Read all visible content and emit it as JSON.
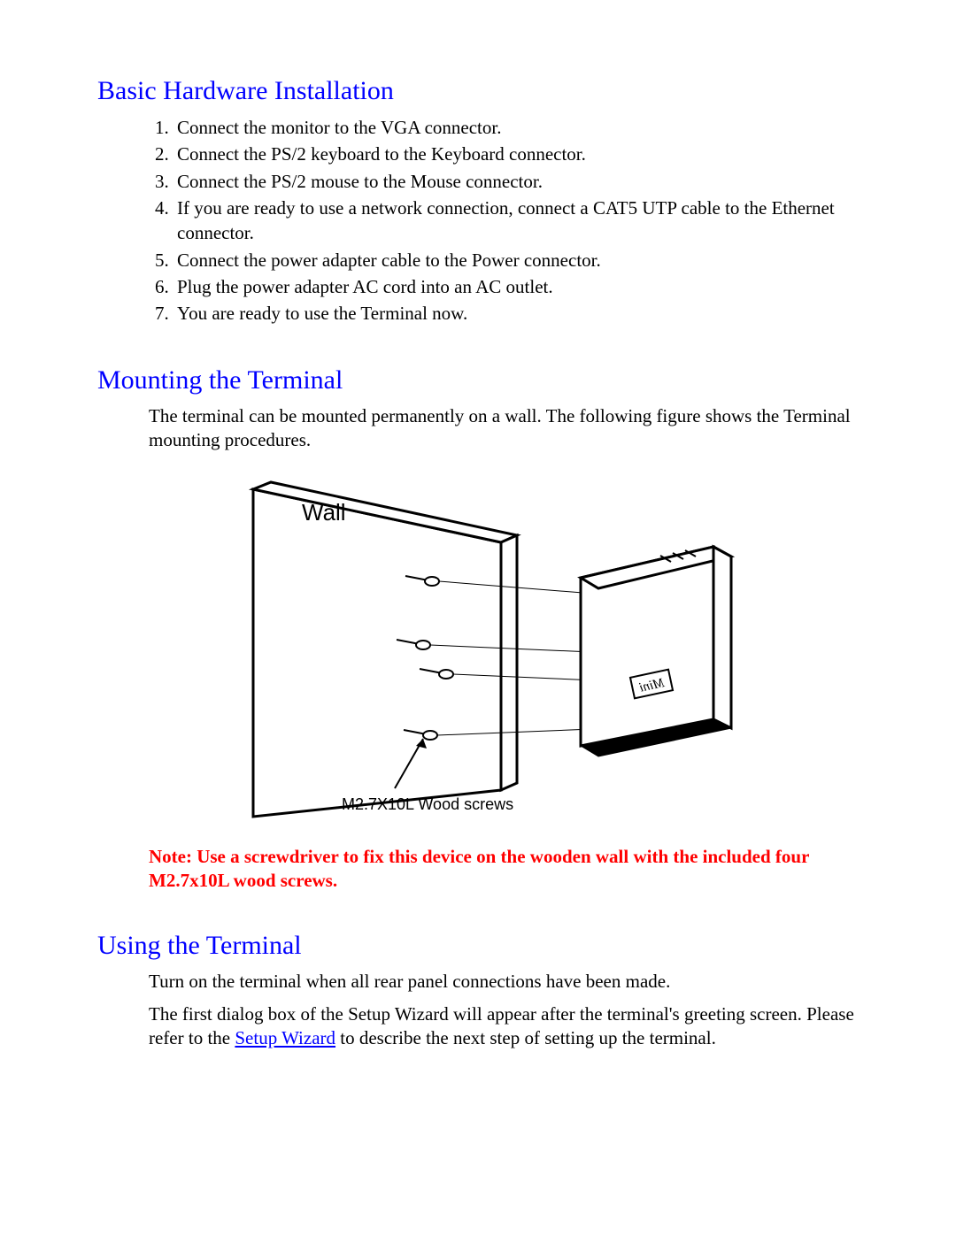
{
  "section1": {
    "heading": "Basic Hardware Installation",
    "steps": [
      "Connect the monitor to the VGA connector.",
      "Connect the PS/2 keyboard to the Keyboard connector.",
      "Connect the PS/2 mouse to the Mouse connector.",
      "If you are ready to use a network connection, connect a CAT5 UTP cable to the Ethernet connector.",
      "Connect the power adapter cable to the Power connector.",
      "Plug the power adapter AC cord into an AC outlet.",
      "You are ready to use the Terminal now."
    ]
  },
  "section2": {
    "heading": "Mounting the Terminal",
    "intro": "The terminal can be mounted permanently on a wall. The following figure shows the Terminal mounting procedures.",
    "figure": {
      "wall_label": "Wall",
      "screws_label": "M2.7X10L Wood screws",
      "device_label": "Mini"
    },
    "note": "Note: Use a screwdriver to fix this device on the wooden wall with the included four M2.7x10L wood screws."
  },
  "section3": {
    "heading": "Using the Terminal",
    "p1": "Turn on the terminal when all rear panel connections have been made.",
    "p2_pre": "The first dialog box of the Setup Wizard will appear after the terminal's greeting screen. Please refer to the ",
    "link_text": "Setup Wizard",
    "p2_post": " to describe the next step of setting up the terminal."
  }
}
